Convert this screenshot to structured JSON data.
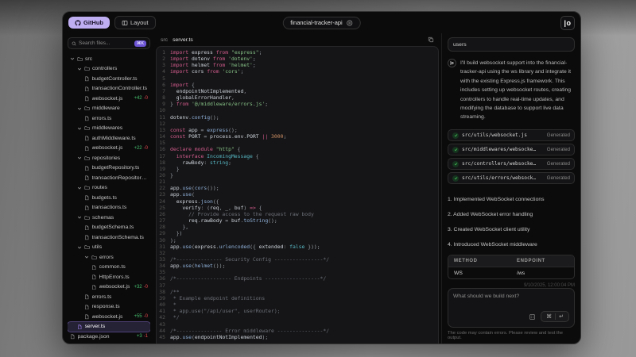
{
  "colors": {
    "accent_purple": "#bfaef2",
    "diff_add": "#46c06c",
    "diff_del": "#e5484d",
    "check_green": "#3fb950"
  },
  "topbar": {
    "github_label": "GitHub",
    "layout_label": "Layout",
    "repo_name": "financial-tracker-api",
    "logo_glyph": "|o"
  },
  "sidebar": {
    "search_placeholder": "Search files...",
    "search_shortcut": "⌘K",
    "tree": [
      {
        "label": "src",
        "type": "folder",
        "depth": 0
      },
      {
        "label": "controllers",
        "type": "folder",
        "depth": 1
      },
      {
        "label": "budgetController.ts",
        "type": "file",
        "depth": 2
      },
      {
        "label": "transactionController.ts",
        "type": "file",
        "depth": 2
      },
      {
        "label": "websocket.js",
        "type": "file",
        "depth": 2,
        "added": "+42",
        "removed": "-0"
      },
      {
        "label": "middleware",
        "type": "folder",
        "depth": 1
      },
      {
        "label": "errors.ts",
        "type": "file",
        "depth": 2
      },
      {
        "label": "middlewares",
        "type": "folder",
        "depth": 1
      },
      {
        "label": "authMiddleware.ts",
        "type": "file",
        "depth": 2
      },
      {
        "label": "websocket.js",
        "type": "file",
        "depth": 2,
        "added": "+22",
        "removed": "-0"
      },
      {
        "label": "repositories",
        "type": "folder",
        "depth": 1
      },
      {
        "label": "budgetRepository.ts",
        "type": "file",
        "depth": 2
      },
      {
        "label": "transactionRepository.ts",
        "type": "file",
        "depth": 2
      },
      {
        "label": "routes",
        "type": "folder",
        "depth": 1
      },
      {
        "label": "budgets.ts",
        "type": "file",
        "depth": 2
      },
      {
        "label": "transactions.ts",
        "type": "file",
        "depth": 2
      },
      {
        "label": "schemas",
        "type": "folder",
        "depth": 1
      },
      {
        "label": "budgetSchema.ts",
        "type": "file",
        "depth": 2
      },
      {
        "label": "transactionSchema.ts",
        "type": "file",
        "depth": 2
      },
      {
        "label": "utils",
        "type": "folder",
        "depth": 1
      },
      {
        "label": "errors",
        "type": "folder",
        "depth": 2
      },
      {
        "label": "common.ts",
        "type": "file",
        "depth": 3
      },
      {
        "label": "HttpErrors.ts",
        "type": "file",
        "depth": 3
      },
      {
        "label": "websocket.js",
        "type": "file",
        "depth": 3,
        "added": "+32",
        "removed": "-0"
      },
      {
        "label": "errors.ts",
        "type": "file",
        "depth": 2
      },
      {
        "label": "response.ts",
        "type": "file",
        "depth": 2
      },
      {
        "label": "websocket.js",
        "type": "file",
        "depth": 2,
        "added": "+55",
        "removed": "-0"
      },
      {
        "label": "server.ts",
        "type": "file",
        "depth": 1,
        "selected": true
      },
      {
        "label": "package.json",
        "type": "file",
        "depth": 0,
        "added": "+3",
        "removed": "-1"
      }
    ]
  },
  "editor": {
    "breadcrumb": [
      "src",
      "server.ts"
    ],
    "lines": [
      [
        [
          "k",
          "import"
        ],
        [
          "i",
          " express "
        ],
        [
          "k",
          "from"
        ],
        [
          "s",
          " \"express\""
        ],
        [
          "p",
          ";"
        ]
      ],
      [
        [
          "k",
          "import"
        ],
        [
          "i",
          " dotenv "
        ],
        [
          "k",
          "from"
        ],
        [
          "s",
          " 'dotenv'"
        ],
        [
          "p",
          ";"
        ]
      ],
      [
        [
          "k",
          "import"
        ],
        [
          "i",
          " helmet "
        ],
        [
          "k",
          "from"
        ],
        [
          "s",
          " 'helmet'"
        ],
        [
          "p",
          ";"
        ]
      ],
      [
        [
          "k",
          "import"
        ],
        [
          "i",
          " cors "
        ],
        [
          "k",
          "from"
        ],
        [
          "s",
          " 'cors'"
        ],
        [
          "p",
          ";"
        ]
      ],
      [],
      [
        [
          "k",
          "import"
        ],
        [
          "p",
          " {"
        ]
      ],
      [
        [
          "i",
          "  endpointNotImplemented"
        ],
        [
          "p",
          ","
        ]
      ],
      [
        [
          "i",
          "  globalErrorHandler"
        ],
        [
          "p",
          ","
        ]
      ],
      [
        [
          "p",
          "} "
        ],
        [
          "k",
          "from"
        ],
        [
          "s",
          " '@/middleware/errors.js'"
        ],
        [
          "p",
          ";"
        ]
      ],
      [],
      [
        [
          "i",
          "dotenv"
        ],
        [
          "p",
          "."
        ],
        [
          "f",
          "config"
        ],
        [
          "p",
          "();"
        ]
      ],
      [],
      [
        [
          "k",
          "const"
        ],
        [
          "i",
          " app "
        ],
        [
          "p",
          "= "
        ],
        [
          "f",
          "express"
        ],
        [
          "p",
          "();"
        ]
      ],
      [
        [
          "k",
          "const"
        ],
        [
          "i",
          " PORT "
        ],
        [
          "p",
          "= "
        ],
        [
          "i",
          "process"
        ],
        [
          "p",
          "."
        ],
        [
          "i",
          "env"
        ],
        [
          "p",
          "."
        ],
        [
          "i",
          "PORT"
        ],
        [
          "k",
          " ||"
        ],
        [
          "n",
          " 3000"
        ],
        [
          "p",
          ";"
        ]
      ],
      [],
      [
        [
          "k",
          "declare module"
        ],
        [
          "s",
          " \"http\""
        ],
        [
          "p",
          " {"
        ]
      ],
      [
        [
          "k",
          "  interface"
        ],
        [
          "t",
          " IncomingMessage"
        ],
        [
          "p",
          " {"
        ]
      ],
      [
        [
          "i",
          "    rawBody"
        ],
        [
          "p",
          ": "
        ],
        [
          "t",
          "string"
        ],
        [
          "p",
          ";"
        ]
      ],
      [
        [
          "p",
          "  }"
        ]
      ],
      [
        [
          "p",
          "}"
        ]
      ],
      [],
      [
        [
          "i",
          "app"
        ],
        [
          "p",
          "."
        ],
        [
          "f",
          "use"
        ],
        [
          "p",
          "("
        ],
        [
          "f",
          "cors"
        ],
        [
          "p",
          "());"
        ]
      ],
      [
        [
          "i",
          "app"
        ],
        [
          "p",
          "."
        ],
        [
          "f",
          "use"
        ],
        [
          "p",
          "("
        ]
      ],
      [
        [
          "i",
          "  express"
        ],
        [
          "p",
          "."
        ],
        [
          "f",
          "json"
        ],
        [
          "p",
          "({"
        ]
      ],
      [
        [
          "i",
          "    verify"
        ],
        [
          "p",
          ": ("
        ],
        [
          "i",
          "req"
        ],
        [
          "p",
          ", "
        ],
        [
          "i",
          "_"
        ],
        [
          "p",
          ", "
        ],
        [
          "i",
          "buf"
        ],
        [
          "p",
          ") "
        ],
        [
          "k",
          "=>"
        ],
        [
          "p",
          " {"
        ]
      ],
      [
        [
          "c",
          "      // Provide access to the request raw body"
        ]
      ],
      [
        [
          "i",
          "      req"
        ],
        [
          "p",
          "."
        ],
        [
          "i",
          "rawBody"
        ],
        [
          "p",
          " = "
        ],
        [
          "i",
          "buf"
        ],
        [
          "p",
          "."
        ],
        [
          "f",
          "toString"
        ],
        [
          "p",
          "();"
        ]
      ],
      [
        [
          "p",
          "    },"
        ]
      ],
      [
        [
          "p",
          "  })"
        ]
      ],
      [
        [
          "p",
          ");"
        ]
      ],
      [
        [
          "i",
          "app"
        ],
        [
          "p",
          "."
        ],
        [
          "f",
          "use"
        ],
        [
          "p",
          "("
        ],
        [
          "i",
          "express"
        ],
        [
          "p",
          "."
        ],
        [
          "f",
          "urlencoded"
        ],
        [
          "p",
          "({ "
        ],
        [
          "i",
          "extended"
        ],
        [
          "p",
          ": "
        ],
        [
          "t",
          "false"
        ],
        [
          "p",
          " }));"
        ]
      ],
      [],
      [
        [
          "c",
          "/*--------------- Security Config ----------------*/"
        ]
      ],
      [
        [
          "i",
          "app"
        ],
        [
          "p",
          "."
        ],
        [
          "f",
          "use"
        ],
        [
          "p",
          "("
        ],
        [
          "f",
          "helmet"
        ],
        [
          "p",
          "());"
        ]
      ],
      [],
      [
        [
          "c",
          "/*------------------ Endpoints ------------------*/"
        ]
      ],
      [],
      [
        [
          "c",
          "/**"
        ]
      ],
      [
        [
          "c",
          " * Example endpoint definitions"
        ]
      ],
      [
        [
          "c",
          " *"
        ]
      ],
      [
        [
          "c",
          " * app.use(\"/api/user\", userRouter);"
        ]
      ],
      [
        [
          "c",
          " */"
        ]
      ],
      [],
      [
        [
          "c",
          "/*--------------- Error middleware ---------------*/"
        ]
      ],
      [
        [
          "i",
          "app"
        ],
        [
          "p",
          "."
        ],
        [
          "f",
          "use"
        ],
        [
          "p",
          "("
        ],
        [
          "i",
          "endpointNotImplemented"
        ],
        [
          "p",
          ");"
        ]
      ]
    ]
  },
  "chat": {
    "user_message": "users",
    "assistant_intro": "I'll build websocket support into the financial-tracker-api using the ws library and integrate it with the existing Express.js framework. This includes setting up websocket routes, creating controllers to handle real-time updates, and modifying the database to support live data streaming.",
    "generated_files": [
      {
        "path": "src/utils/websocket.js",
        "status": "Generated"
      },
      {
        "path": "src/middlewares/websocke…",
        "status": "Generated"
      },
      {
        "path": "src/controllers/websocke…",
        "status": "Generated"
      },
      {
        "path": "src/utils/errors/websock…",
        "status": "Generated"
      }
    ],
    "steps": [
      "Implemented WebSocket connections",
      "Added WebSocket error handling",
      "Created WebSocket client utility",
      "Introduced WebSocket middleware"
    ],
    "endpoint_table": {
      "headers": [
        "METHOD",
        "ENDPOINT"
      ],
      "rows": [
        [
          "WS",
          "/ws"
        ]
      ]
    },
    "timestamp": "9/10/2025, 12:00:04 PM",
    "input_placeholder": "What should we build next?",
    "send_shortcut_cmd": "⌘",
    "send_shortcut_enter": "↵",
    "disclaimer": "The code may contain errors. Please review and test the output."
  }
}
